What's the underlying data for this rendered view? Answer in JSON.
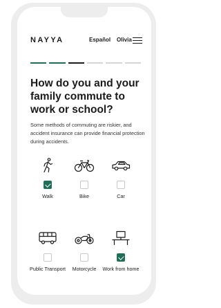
{
  "header": {
    "logo": "NAYYA",
    "language_label": "Español",
    "user_name": "Olivia",
    "menu_icon": "hamburger-menu-icon"
  },
  "progress": {
    "segments": 6,
    "completed": 3,
    "current_index": 2,
    "colors": {
      "done": "#1f6f58",
      "current": "#1b1b1b",
      "todo": "#d5d5d5"
    }
  },
  "question": {
    "title": "How do you and your family commute to work or school?",
    "description": "Some methods of commuting are riskier, and accident insurance can provide financial protection during accidents."
  },
  "options": [
    {
      "label": "Walk",
      "icon": "walking-person-icon",
      "checked": true
    },
    {
      "label": "Bike",
      "icon": "bicycle-icon",
      "checked": false
    },
    {
      "label": "Car",
      "icon": "car-icon",
      "checked": false
    },
    {
      "label": "Public Transport",
      "icon": "bus-icon",
      "checked": false
    },
    {
      "label": "Motorcycle",
      "icon": "motorcycle-icon",
      "checked": false
    },
    {
      "label": "Work from home",
      "icon": "desk-computer-icon",
      "checked": true
    }
  ],
  "colors": {
    "accent": "#1f6f58",
    "text": "#1b1b1b",
    "frame": "#ededed"
  }
}
